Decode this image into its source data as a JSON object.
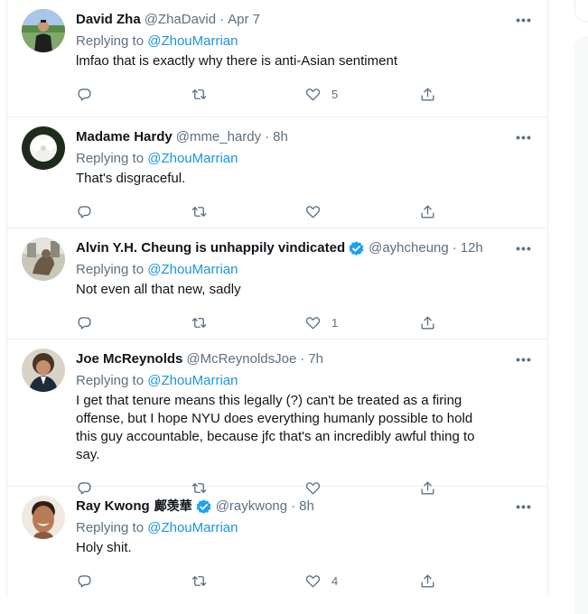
{
  "reply_prefix": "Replying to",
  "tweets": [
    {
      "name": "David Zha",
      "handle": "@ZhaDavid",
      "time": "Apr 7",
      "mention": "@ZhouMarrian",
      "text": "lmfao that is exactly why there is anti-Asian sentiment",
      "likes": "5"
    },
    {
      "name": "Madame Hardy",
      "handle": "@mme_hardy",
      "time": "8h",
      "mention": "@ZhouMarrian",
      "text": "That's disgraceful.",
      "likes": ""
    },
    {
      "name": "Alvin Y.H. Cheung is unhappily vindicated",
      "handle": "@ayhcheung",
      "time": "12h",
      "mention": "@ZhouMarrian",
      "text": "Not even all that new, sadly",
      "likes": "1",
      "verified": true
    },
    {
      "name": "Joe McReynolds",
      "handle": "@McReynoldsJoe",
      "time": "7h",
      "mention": "@ZhouMarrian",
      "text": "I get that tenure means this legally (?) can't be treated as a firing offense, but I hope NYU does everything humanly possible to hold this guy accountable, because jfc that's an incredibly awful thing to say.",
      "likes": ""
    },
    {
      "name": "Ray Kwong",
      "name_cjk": "鄺羡華",
      "handle": "@raykwong",
      "time": "8h",
      "mention": "@ZhouMarrian",
      "text": "Holy shit.",
      "likes": "4",
      "verified": true
    }
  ],
  "colors": {
    "link": "#1b95e0",
    "secondary_text": "#5b7083",
    "verified": "#1da1f2",
    "border": "#ebeef0"
  },
  "icons": [
    "reply-icon",
    "retweet-icon",
    "like-icon",
    "share-icon",
    "more-icon",
    "verified-badge-icon"
  ]
}
